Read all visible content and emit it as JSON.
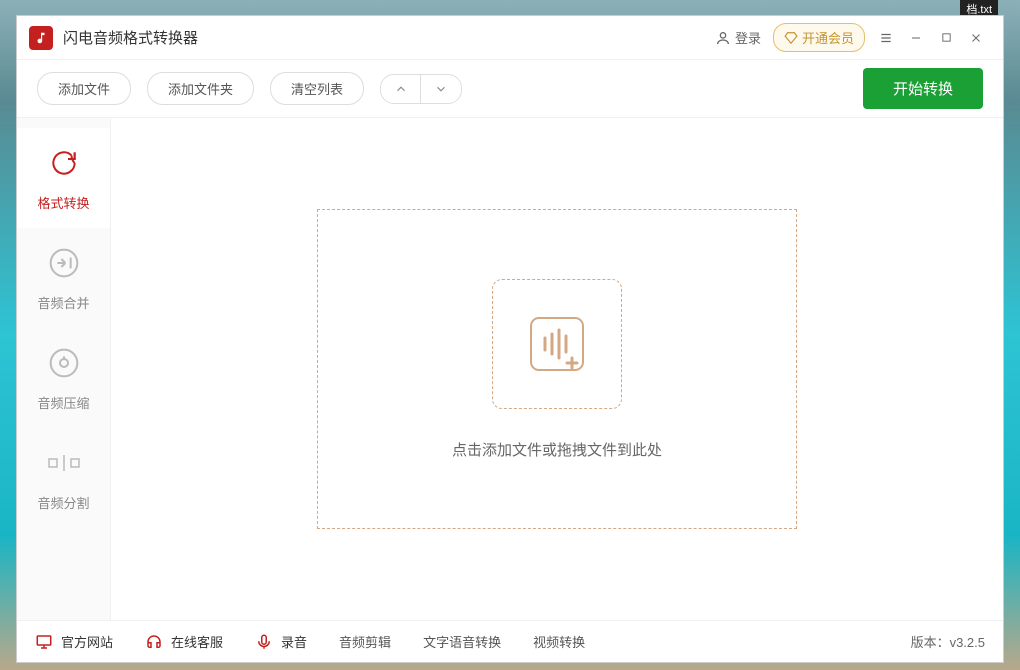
{
  "desktop": {
    "corner_label": "档.txt"
  },
  "app": {
    "title": "闪电音频格式转换器"
  },
  "titlebar": {
    "login_label": "登录",
    "vip_label": "开通会员"
  },
  "toolbar": {
    "add_file": "添加文件",
    "add_folder": "添加文件夹",
    "clear_list": "清空列表",
    "start": "开始转换"
  },
  "sidebar": {
    "items": [
      {
        "label": "格式转换"
      },
      {
        "label": "音频合并"
      },
      {
        "label": "音频压缩"
      },
      {
        "label": "音频分割"
      }
    ]
  },
  "dropzone": {
    "hint": "点击添加文件或拖拽文件到此处"
  },
  "footer": {
    "official_site": "官方网站",
    "support": "在线客服",
    "record": "录音",
    "audio_cut": "音频剪辑",
    "tts": "文字语音转换",
    "video_convert": "视频转换",
    "version_label": "版本：",
    "version_value": "v3.2.5"
  }
}
